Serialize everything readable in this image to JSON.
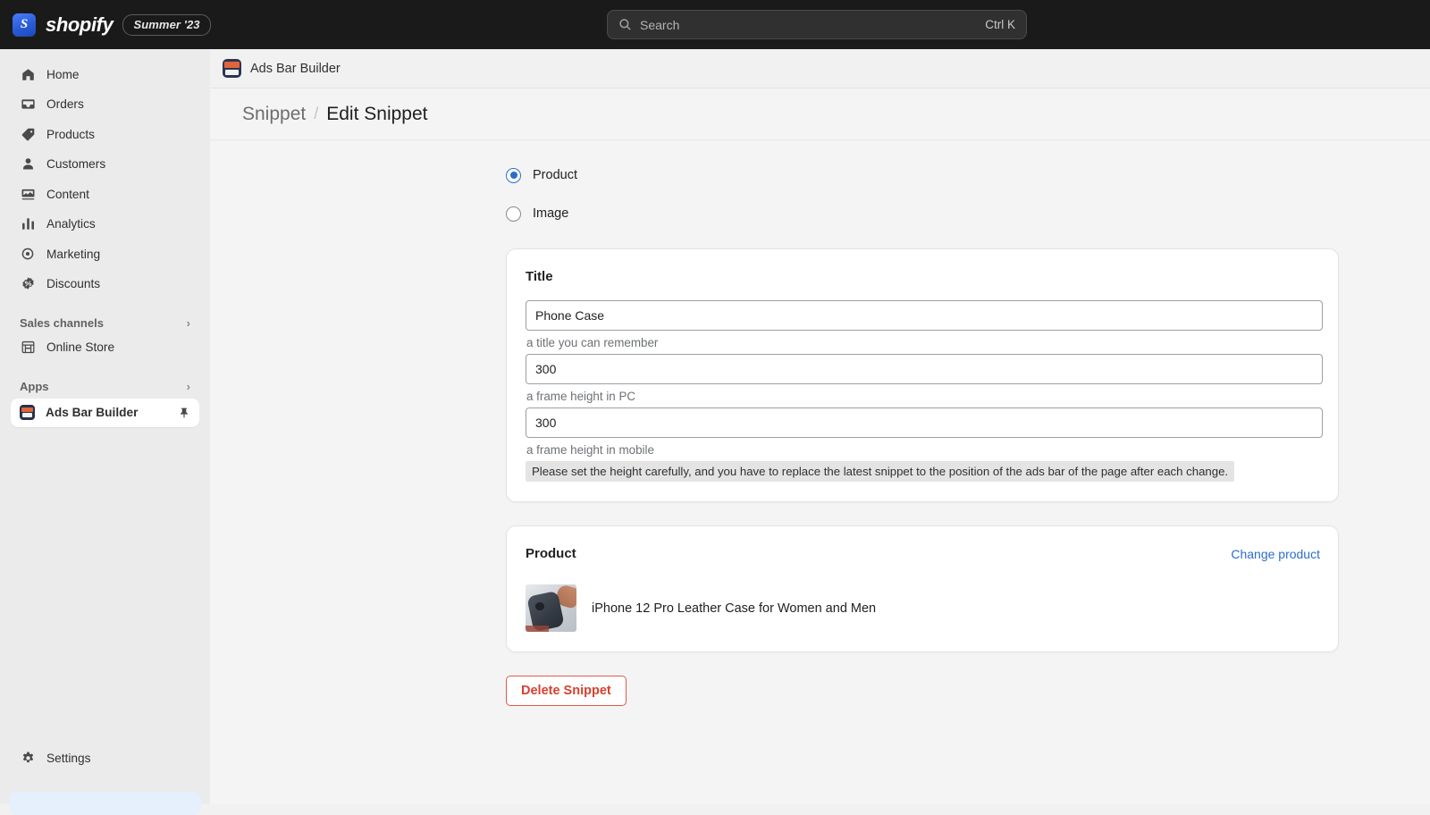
{
  "topbar": {
    "brand_mark": "S",
    "brand_name": "shopify",
    "season_badge": "Summer '23",
    "search": {
      "icon": "search-icon",
      "placeholder": "Search",
      "shortcut": "Ctrl K"
    }
  },
  "sidebar": {
    "items": [
      {
        "label": "Home",
        "icon": "home-icon"
      },
      {
        "label": "Orders",
        "icon": "orders-icon"
      },
      {
        "label": "Products",
        "icon": "tag-icon"
      },
      {
        "label": "Customers",
        "icon": "person-icon"
      },
      {
        "label": "Content",
        "icon": "content-icon"
      },
      {
        "label": "Analytics",
        "icon": "bar-chart-icon"
      },
      {
        "label": "Marketing",
        "icon": "target-icon"
      },
      {
        "label": "Discounts",
        "icon": "discount-icon"
      }
    ],
    "sales_channels": {
      "label": "Sales channels",
      "chevron": "›",
      "items": [
        {
          "label": "Online Store",
          "icon": "store-icon"
        }
      ]
    },
    "apps": {
      "label": "Apps",
      "chevron": "›",
      "items": [
        {
          "label": "Ads Bar Builder",
          "icon": "ads-bar-builder-app-icon",
          "pin": "pin-icon",
          "active": true
        }
      ]
    },
    "settings": {
      "label": "Settings",
      "icon": "gear-icon"
    }
  },
  "app_header": {
    "icon": "ads-bar-builder-app-icon",
    "title": "Ads Bar Builder"
  },
  "breadcrumb": {
    "parent": "Snippet",
    "separator": "/",
    "current": "Edit Snippet"
  },
  "main": {
    "source_type": {
      "options": [
        {
          "label": "Product",
          "checked": true
        },
        {
          "label": "Image",
          "checked": false
        }
      ]
    },
    "title_card": {
      "heading": "Title",
      "fields": [
        {
          "value": "Phone Case",
          "help": "a title you can remember"
        },
        {
          "value": "300",
          "help": "a frame height in PC"
        },
        {
          "value": "300",
          "help": "a frame height in mobile"
        }
      ],
      "warning": "Please set the height carefully, and you have to replace the latest snippet to the position of the ads bar of the page after each change."
    },
    "product_card": {
      "heading": "Product",
      "change_link": "Change product",
      "product_name": "iPhone 12 Pro Leather Case for Women and Men",
      "thumbnail_alt": "product-thumbnail"
    },
    "delete_button": "Delete Snippet"
  },
  "colors": {
    "accent": "#2c6ecb",
    "danger": "#d8402f",
    "topbar_bg": "#1a1a1a",
    "sidebar_bg": "#ebebeb",
    "canvas_bg": "#f4f4f4"
  }
}
